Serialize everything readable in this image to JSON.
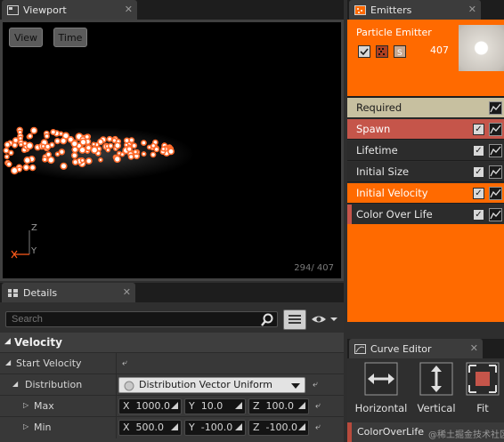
{
  "viewport": {
    "tab_title": "Viewport",
    "view_btn": "View",
    "time_btn": "Time",
    "particle_count": "294/ 407",
    "axis_z": "Z",
    "axis_y": "Y"
  },
  "emitters": {
    "tab_title": "Emitters",
    "emitter_name": "Particle Emitter",
    "emitter_count": "407",
    "modules": [
      {
        "label": "Required"
      },
      {
        "label": "Spawn"
      },
      {
        "label": "Lifetime"
      },
      {
        "label": "Initial Size"
      },
      {
        "label": "Initial Velocity"
      },
      {
        "label": "Color Over Life"
      }
    ]
  },
  "details": {
    "tab_title": "Details",
    "search_placeholder": "Search",
    "category": "Velocity",
    "start_velocity_label": "Start Velocity",
    "distribution_label": "Distribution",
    "distribution_value": "Distribution Vector Uniform",
    "max_label": "Max",
    "min_label": "Min",
    "max": {
      "x": "1000.0",
      "y": "10.0",
      "z": "100.0"
    },
    "min": {
      "x": "500.0",
      "y": "-100.0",
      "z": "-100.0"
    },
    "x": "X",
    "y": "Y",
    "z": "Z"
  },
  "curve_editor": {
    "tab_title": "Curve Editor",
    "horizontal": "Horizontal",
    "vertical": "Vertical",
    "fit": "Fit",
    "track_label": "ColorOverLife"
  },
  "watermark": "@稀土掘金技术社区",
  "colors": {
    "accent": "#ff6a00",
    "required": "#c7c0a0",
    "spawn": "#c5554a",
    "row_dark": "#2c2c2c"
  }
}
